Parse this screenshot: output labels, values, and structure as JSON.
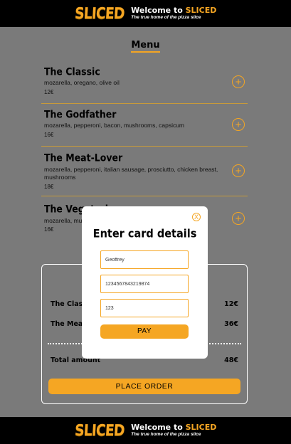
{
  "header": {
    "logo": "SLICED",
    "welcome": "Welcome to ",
    "brand": "SLICED",
    "tagline": "The true home of the pizza slice"
  },
  "menu": {
    "title": "Menu",
    "items": [
      {
        "name": "The Classic",
        "desc": "mozarella, oregano, olive oil",
        "price": "12€"
      },
      {
        "name": "The Godfather",
        "desc": "mozarella, pepperoni, bacon, mushrooms, capsicum",
        "price": "16€"
      },
      {
        "name": "The Meat-Lover",
        "desc": "mozarella, pepperoni, italian sausage, prosciutto, chicken breast, mushrooms",
        "price": "18€"
      },
      {
        "name": "The Vegetarian",
        "desc": "mozarella, mushrooms",
        "price": "16€"
      }
    ],
    "add_symbol": "+"
  },
  "order": {
    "lines": [
      {
        "name": "The Classic",
        "price": "12€"
      },
      {
        "name": "The Meat-Lover",
        "price": "36€"
      }
    ],
    "total_label": "Total amount",
    "total_value": "48€",
    "place_order_label": "PLACE ORDER"
  },
  "modal": {
    "close_symbol": "X",
    "title": "Enter card details",
    "name_value": "Geoffrey",
    "card_number_value": "1234567843219874",
    "cvv_value": "123",
    "pay_label": "PAY"
  },
  "footer": {
    "logo": "SLICED",
    "welcome": "Welcome to ",
    "brand": "SLICED",
    "tagline": "The true home of the pizza slice"
  },
  "colors": {
    "accent": "#f5a623",
    "overlay_bg": "#7a7a7a",
    "bar_bg": "#000000"
  }
}
